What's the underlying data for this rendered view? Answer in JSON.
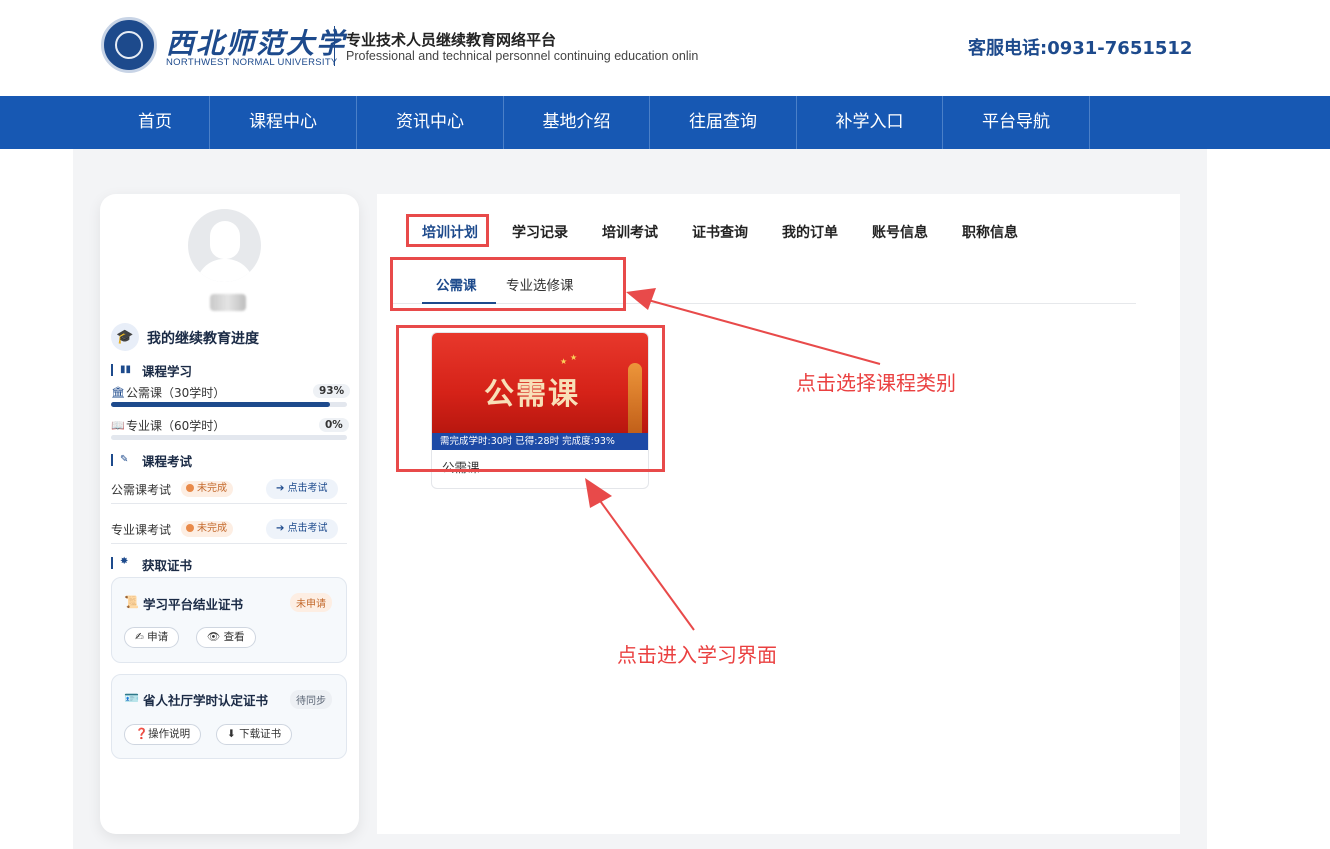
{
  "header": {
    "logo_cn": "西北师范大学",
    "logo_en": "NORTHWEST NORMAL UNIVERSITY",
    "platform_title": "专业技术人员继续教育网络平台",
    "platform_subtitle": "Professional and technical personnel continuing education onlin",
    "hotline": "客服电话:0931-7651512"
  },
  "nav": {
    "items": [
      "首页",
      "课程中心",
      "资讯中心",
      "基地介绍",
      "往届查询",
      "补学入口",
      "平台导航"
    ]
  },
  "sidebar": {
    "progress_title": "我的继续教育进度",
    "course_study": {
      "heading": "课程学习",
      "items": [
        {
          "label": "公需课（30学时）",
          "percent": "93%",
          "progress": 0.93,
          "icon": "institution-icon"
        },
        {
          "label": "专业课（60学时）",
          "percent": "0%",
          "progress": 0.0,
          "icon": "book-reader-icon"
        }
      ]
    },
    "course_exam": {
      "heading": "课程考试",
      "items": [
        {
          "label": "公需课考试",
          "status": "未完成",
          "action": "点击考试"
        },
        {
          "label": "专业课考试",
          "status": "未完成",
          "action": "点击考试"
        }
      ]
    },
    "certificates": {
      "heading": "获取证书",
      "items": [
        {
          "title": "学习平台结业证书",
          "status": "未申请",
          "buttons": [
            "申请",
            "查看"
          ]
        },
        {
          "title": "省人社厅学时认定证书",
          "status": "待同步",
          "buttons": [
            "操作说明",
            "下载证书"
          ]
        }
      ]
    }
  },
  "tabs": {
    "items": [
      "培训计划",
      "学习记录",
      "培训考试",
      "证书查询",
      "我的订单",
      "账号信息",
      "职称信息"
    ],
    "active": "培训计划"
  },
  "subtabs": {
    "items": [
      "公需课",
      "专业选修课"
    ],
    "active": "公需课"
  },
  "course_card": {
    "banner_text": "公需课",
    "stats": "需完成学时:30时 已得:28时 完成度:93%",
    "name": "公需课"
  },
  "annotations": {
    "select_category": "点击选择课程类别",
    "enter_study": "点击进入学习界面"
  },
  "colors": {
    "primary": "#1d4a8c",
    "nav_bg": "#1758b3",
    "annotation": "#e84a4a",
    "status_warn": "#e98a4a"
  }
}
